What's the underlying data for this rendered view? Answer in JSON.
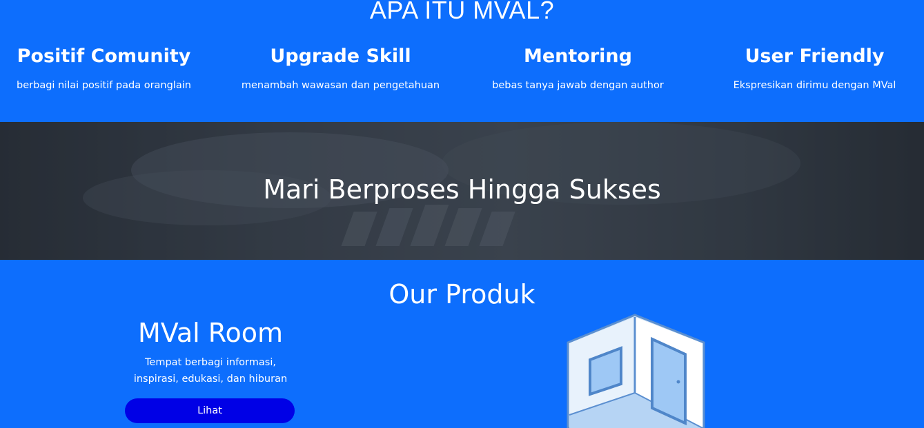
{
  "about": {
    "title": "APA ITU MVAL?",
    "features": [
      {
        "title": "Positif Comunity",
        "desc": "berbagi nilai positif pada oranglain"
      },
      {
        "title": "Upgrade Skill",
        "desc": "menambah wawasan dan pengetahuan"
      },
      {
        "title": "Mentoring",
        "desc": "bebas tanya jawab dengan author"
      },
      {
        "title": "User Friendly",
        "desc": "Ekspresikan dirimu dengan MVal"
      }
    ]
  },
  "banner": {
    "title": "Mari Berproses Hingga Sukses"
  },
  "produk": {
    "title": "Our Produk",
    "room": {
      "title": "MVal Room",
      "desc_line1": "Tempat berbagi informasi,",
      "desc_line2": "inspirasi, edukasi, dan hiburan",
      "button_label": "Lihat",
      "illustration_icon": "room-icon"
    }
  },
  "colors": {
    "primary": "#0d6efd",
    "button": "#0000e6"
  }
}
